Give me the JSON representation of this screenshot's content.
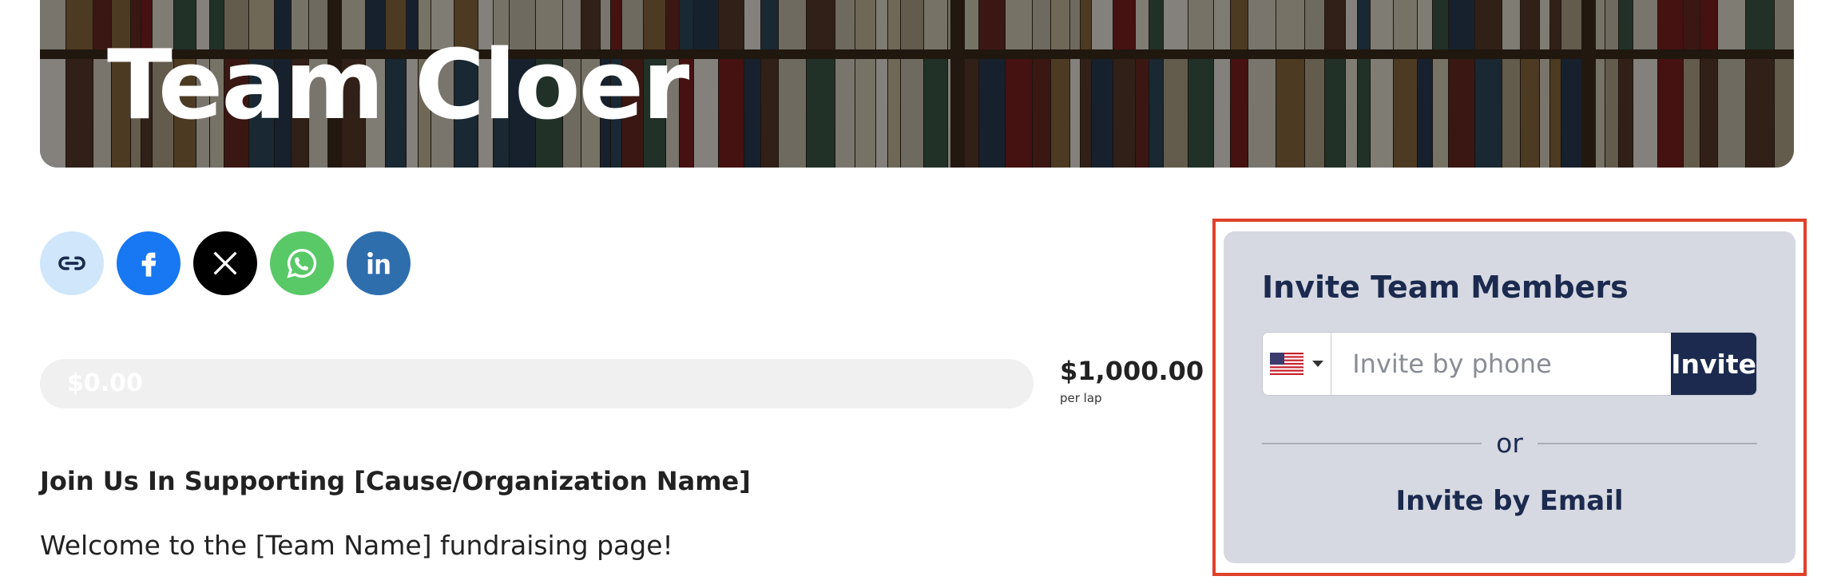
{
  "hero": {
    "title": "Team Cloer"
  },
  "social": {
    "icons": [
      "link-icon",
      "facebook-icon",
      "x-icon",
      "whatsapp-icon",
      "linkedin-icon"
    ]
  },
  "fundraising": {
    "raised_label": "$0.00",
    "progress_fraction": 0,
    "goal_amount": "$1,000.00",
    "goal_unit": "per lap"
  },
  "content": {
    "headline": "Join Us In Supporting [Cause/Organization Name]",
    "welcome": "Welcome to the [Team Name] fundraising page!"
  },
  "invite": {
    "title": "Invite Team Members",
    "country_flag": "us-flag-icon",
    "phone_placeholder": "Invite by phone",
    "invite_button": "Invite",
    "divider_text": "or",
    "email_link": "Invite by Email"
  },
  "colors": {
    "navy": "#1b2a4e",
    "highlight_border": "#e0412a",
    "card_bg": "#d6d9e1",
    "facebook": "#1877f2",
    "whatsapp": "#58c966",
    "linkedin": "#2f6ead"
  }
}
